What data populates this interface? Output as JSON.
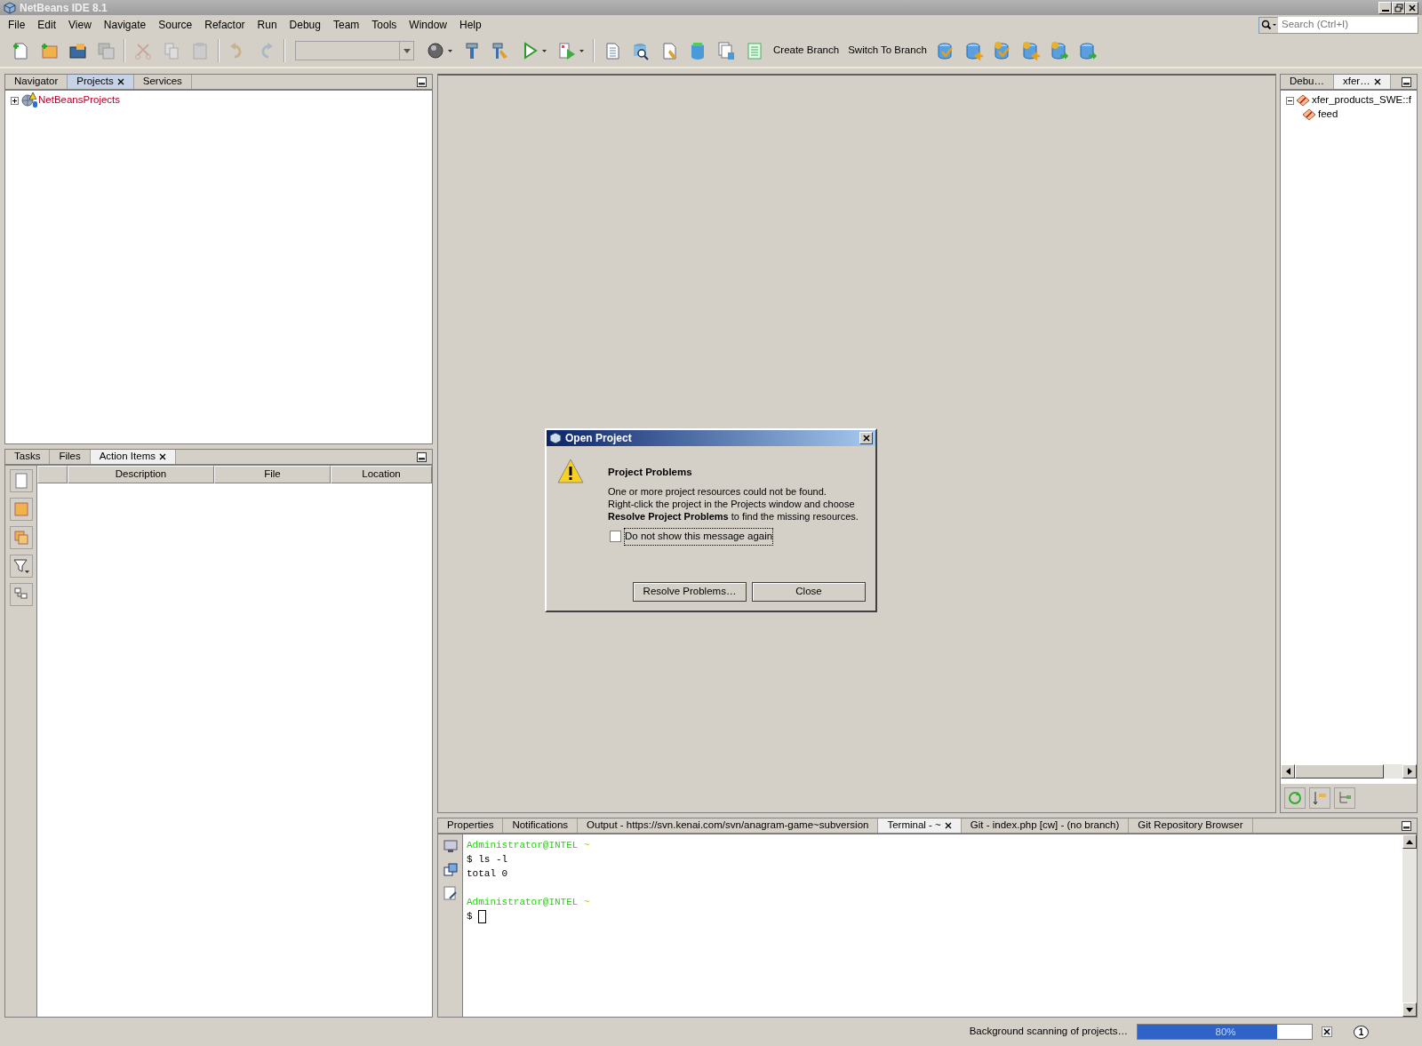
{
  "window": {
    "title": "NetBeans IDE 8.1"
  },
  "menu": [
    "File",
    "Edit",
    "View",
    "Navigate",
    "Source",
    "Refactor",
    "Run",
    "Debug",
    "Team",
    "Tools",
    "Window",
    "Help"
  ],
  "search": {
    "placeholder": "Search (Ctrl+I)"
  },
  "toolbar": {
    "text_buttons": [
      "Create Branch",
      "Switch To Branch"
    ]
  },
  "projects_panel": {
    "tabs": [
      {
        "label": "Navigator",
        "selected": false,
        "closable": false
      },
      {
        "label": "Projects",
        "selected": true,
        "closable": true
      },
      {
        "label": "Services",
        "selected": false,
        "closable": false
      }
    ],
    "tree": [
      {
        "label": "NetBeansProjects",
        "expanded": false,
        "has_problems": true
      }
    ]
  },
  "tasks_panel": {
    "tabs": [
      {
        "label": "Tasks",
        "selected": false,
        "closable": false
      },
      {
        "label": "Files",
        "selected": false,
        "closable": false
      },
      {
        "label": "Action Items",
        "selected": true,
        "closable": true
      }
    ],
    "columns": [
      "Description",
      "File",
      "Location"
    ]
  },
  "right_panel": {
    "tabs": [
      {
        "label": "Debu…",
        "selected": false,
        "closable": false
      },
      {
        "label": "xfer…",
        "selected": true,
        "closable": true
      }
    ],
    "tree": [
      {
        "label": "xfer_products_SWE::f",
        "expanded": true,
        "children": [
          {
            "label": "feed"
          }
        ]
      }
    ]
  },
  "output_panel": {
    "tabs": [
      {
        "label": "Properties",
        "selected": false,
        "closable": false
      },
      {
        "label": "Notifications",
        "selected": false,
        "closable": false
      },
      {
        "label": "Output - https://svn.kenai.com/svn/anagram-game~subversion",
        "selected": false,
        "closable": false
      },
      {
        "label": "Terminal - ~",
        "selected": true,
        "closable": true
      },
      {
        "label": "Git - index.php [cw] - (no branch)",
        "selected": false,
        "closable": false
      },
      {
        "label": "Git Repository Browser",
        "selected": false,
        "closable": false
      }
    ],
    "terminal_lines": [
      {
        "kind": "prompt",
        "user": "Administrator@INTEL",
        "dir": "~"
      },
      {
        "kind": "text",
        "text": "$ ls -l"
      },
      {
        "kind": "text",
        "text": "total 0"
      },
      {
        "kind": "blank"
      },
      {
        "kind": "prompt",
        "user": "Administrator@INTEL",
        "dir": "~"
      },
      {
        "kind": "input",
        "text": "$"
      }
    ]
  },
  "dialog": {
    "title": "Open Project",
    "heading": "Project Problems",
    "message": [
      "One or more project resources could not be found.",
      "Right-click the project in the Projects window and choose",
      "**Resolve Project Problems** to find the missing resources."
    ],
    "checkbox": {
      "label": "Do not show this message again",
      "checked": false
    },
    "buttons": [
      "Resolve Problems…",
      "Close"
    ]
  },
  "status_bar": {
    "text": "Background scanning of projects…",
    "progress": {
      "level": 0.8,
      "label": "80%"
    },
    "notification_count": "1"
  }
}
